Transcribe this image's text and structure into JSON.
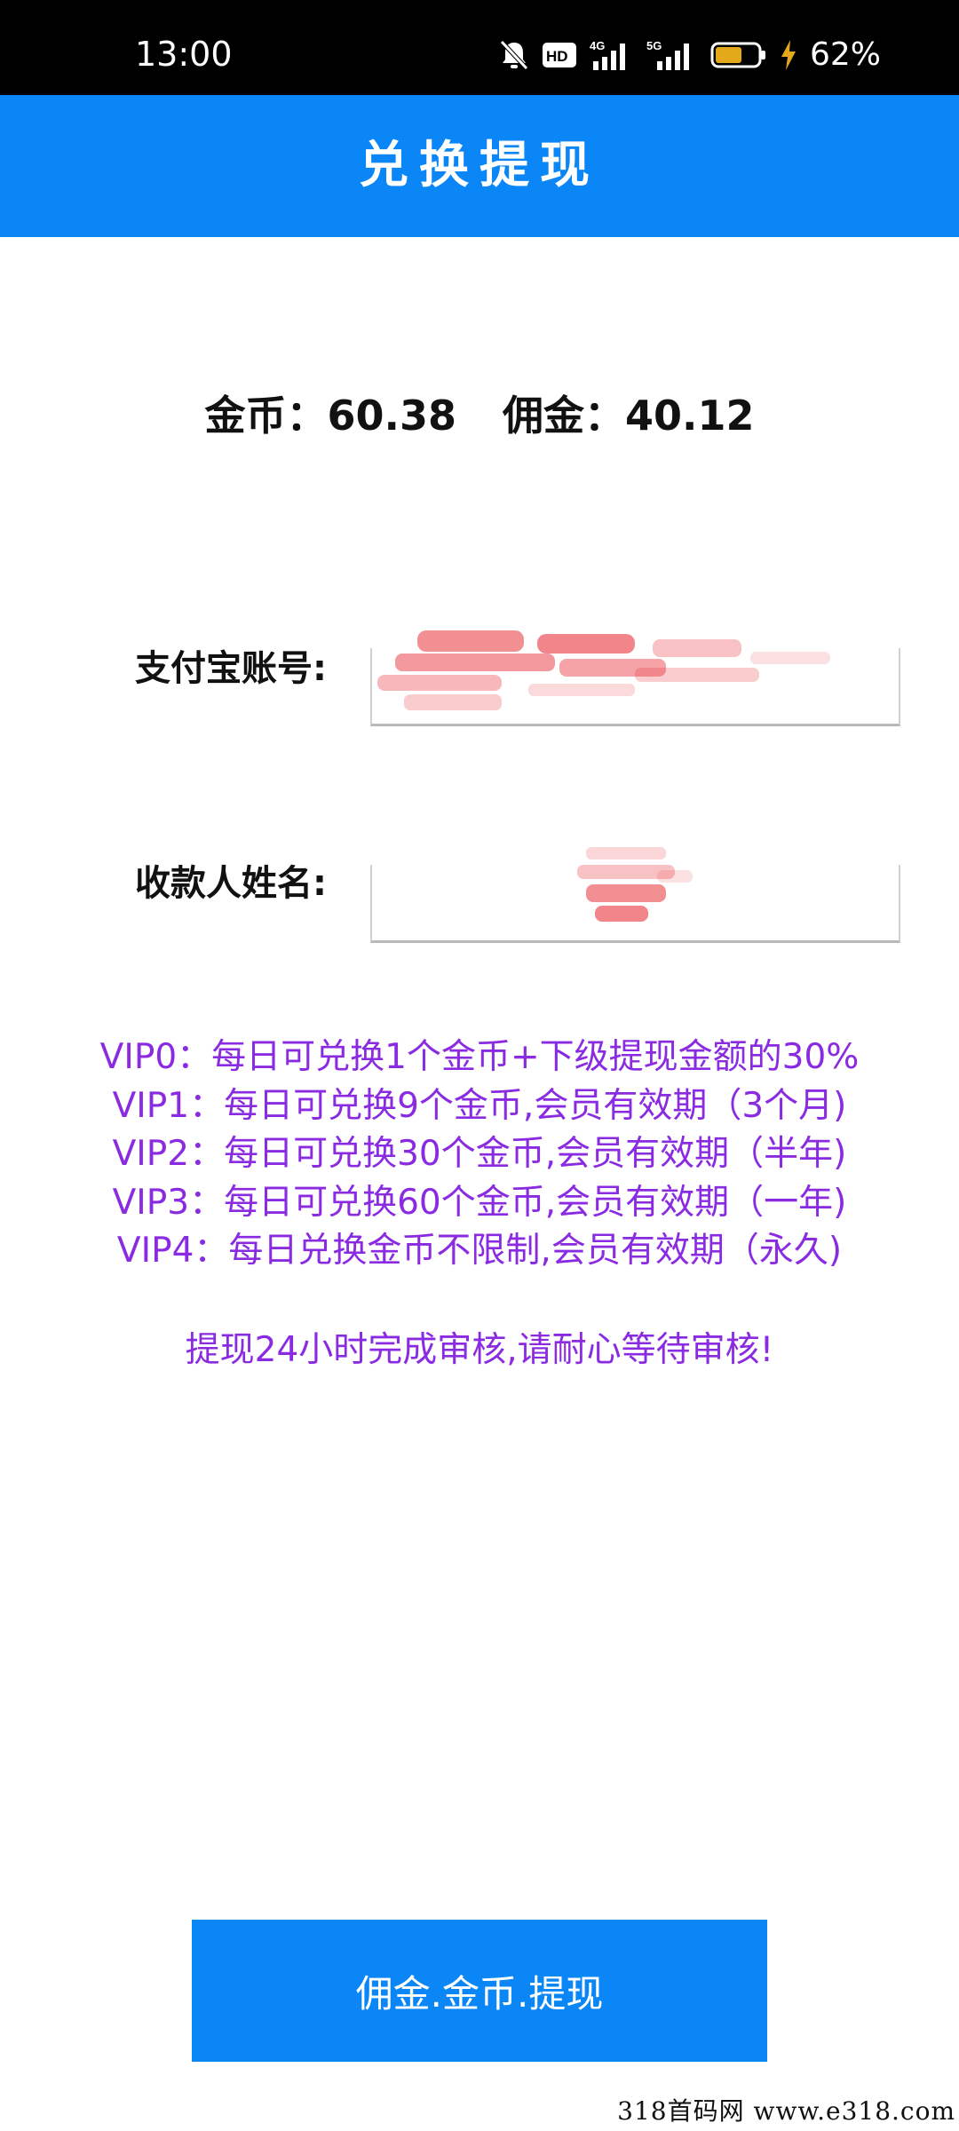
{
  "status_bar": {
    "time": "13:00",
    "battery_percent": "62%",
    "icons": [
      "bell-off-icon",
      "hd-icon",
      "signal-4g-icon",
      "signal-5g-icon",
      "battery-icon",
      "charging-icon"
    ],
    "network_labels": {
      "hd": "HD",
      "sim1": "4G",
      "sim2": "5G"
    },
    "battery_level": 0.62
  },
  "header": {
    "title": "兑换提现"
  },
  "balance": {
    "coin_label": "金币：",
    "coin_value": "60.38",
    "commission_label": "佣金：",
    "commission_value": "40.12"
  },
  "form": {
    "alipay_label": "支付宝账号:",
    "payee_label": "收款人姓名:"
  },
  "vip_tiers": [
    "VIP0：每日可兑换1个金币+下级提现金额的30%",
    "VIP1：每日可兑换9个金币,会员有效期（3个月)",
    "VIP2：每日可兑换30个金币,会员有效期（半年)",
    "VIP3：每日可兑换60个金币,会员有效期（一年)",
    "VIP4：每日兑换金币不限制,会员有效期（永久)"
  ],
  "notice": "提现24小时完成审核,请耐心等待审核!",
  "button": {
    "label": "佣金.金币.提现"
  },
  "watermark": "318首码网  www.e318.com",
  "colors": {
    "status_bar": "#000000",
    "header": "#0a86f7",
    "vip_text": "#8a2be2",
    "button": "#0a86f7",
    "redaction": "#e8333b"
  }
}
